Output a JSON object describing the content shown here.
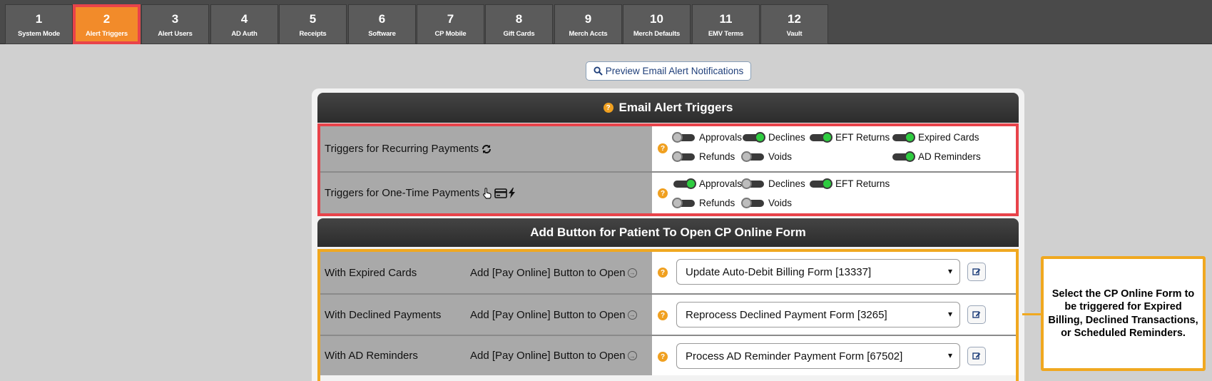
{
  "tabs": [
    {
      "num": "1",
      "label": "System Mode"
    },
    {
      "num": "2",
      "label": "Alert Triggers",
      "active": true
    },
    {
      "num": "3",
      "label": "Alert Users"
    },
    {
      "num": "4",
      "label": "AD Auth"
    },
    {
      "num": "5",
      "label": "Receipts"
    },
    {
      "num": "6",
      "label": "Software"
    },
    {
      "num": "7",
      "label": "CP Mobile"
    },
    {
      "num": "8",
      "label": "Gift Cards"
    },
    {
      "num": "9",
      "label": "Merch Accts"
    },
    {
      "num": "10",
      "label": "Merch Defaults"
    },
    {
      "num": "11",
      "label": "EMV Terms"
    },
    {
      "num": "12",
      "label": "Vault"
    }
  ],
  "preview_button": "Preview Email Alert Notifications",
  "email_triggers": {
    "title": "Email Alert Triggers",
    "recurring": {
      "label": "Triggers for Recurring Payments",
      "toggles": [
        {
          "label": "Approvals",
          "on": false
        },
        {
          "label": "Declines",
          "on": true
        },
        {
          "label": "EFT Returns",
          "on": true
        },
        {
          "label": "Expired Cards",
          "on": true
        },
        {
          "label": "Refunds",
          "on": false
        },
        {
          "label": "Voids",
          "on": false
        },
        {
          "label": "AD Reminders",
          "on": true
        }
      ]
    },
    "onetime": {
      "label": "Triggers for One-Time Payments",
      "toggles": [
        {
          "label": "Approvals",
          "on": true
        },
        {
          "label": "Declines",
          "on": false
        },
        {
          "label": "EFT Returns",
          "on": true
        },
        {
          "label": "Refunds",
          "on": false
        },
        {
          "label": "Voids",
          "on": false
        }
      ]
    }
  },
  "add_button": {
    "title": "Add Button for Patient To Open CP Online Form",
    "rows": [
      {
        "label": "With Expired Cards",
        "sub": "Add [Pay Online] Button to Open",
        "selected": "Update Auto-Debit Billing Form [13337]"
      },
      {
        "label": "With Declined Payments",
        "sub": "Add [Pay Online] Button to Open",
        "selected": "Reprocess Declined Payment Form [3265]"
      },
      {
        "label": "With AD Reminders",
        "sub": "Add [Pay Online] Button to Open",
        "selected": "Process AD Reminder Payment Form [67502]"
      }
    ]
  },
  "callout": "Select the CP Online Form to be triggered for Expired Billing, Declined Transactions, or Scheduled Reminders.",
  "colors": {
    "active_tab": "#f28b2a",
    "highlight_red": "#e8434a",
    "highlight_orange": "#f0a820",
    "toggle_on": "#2ecc40"
  }
}
